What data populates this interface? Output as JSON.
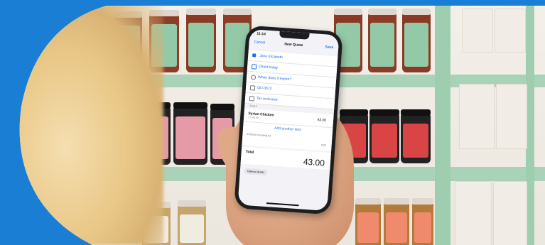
{
  "colors": {
    "background": "#1a7fd4",
    "shelf": "#a9d3b8",
    "accent": "#1a73e8"
  },
  "phone": {
    "status_time": "11:14",
    "nav": {
      "cancel": "Cancel",
      "title": "New Quote",
      "save": "Save"
    },
    "customer": "Jane Elizabeth",
    "rows": [
      {
        "icon": "calendar-icon",
        "text": "Dated today"
      },
      {
        "icon": "clock-icon",
        "text": "When does it expire?"
      },
      {
        "icon": "hash-icon",
        "text": "QU-0672"
      },
      {
        "icon": "tax-icon",
        "text": "Tax exclusive"
      }
    ],
    "items_header": "ITEMS",
    "item": {
      "name": "Syrian Chicken",
      "sub": "1 × 43.00",
      "price": "43.00"
    },
    "add_item": "Add another item",
    "rounding_label": "Enhance rounding tax",
    "rounding_value": "0.00",
    "total_label": "Total",
    "total_value": "43.00",
    "optional_details": "Optional details"
  }
}
